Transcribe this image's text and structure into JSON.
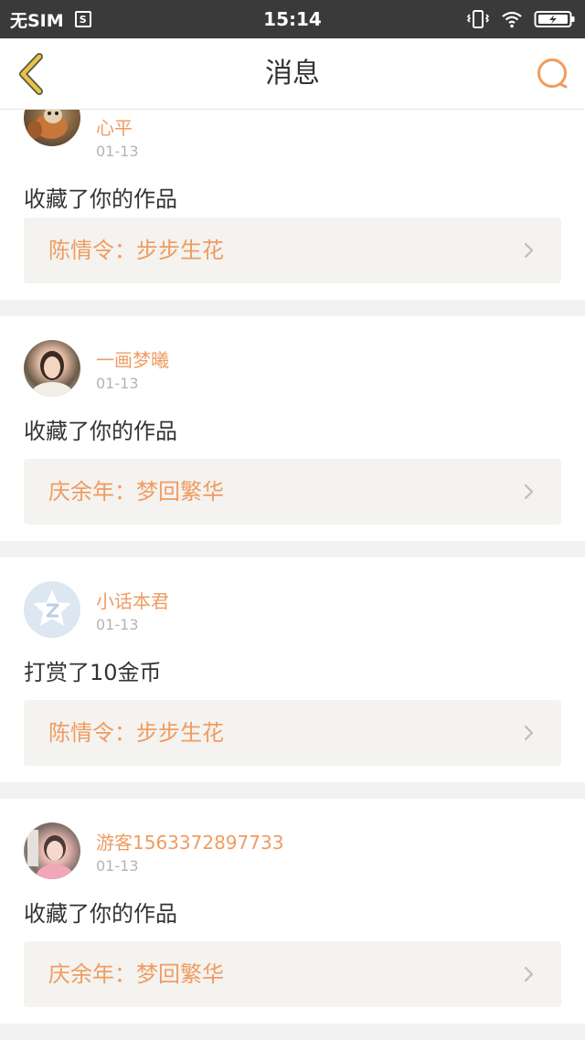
{
  "status_bar": {
    "carrier": "无SIM",
    "sim_icon_text": "S",
    "time": "15:14"
  },
  "header": {
    "title": "消息"
  },
  "colors": {
    "accent": "#ef9c62",
    "back_arrow": "#e8c34c",
    "status_bar_bg": "#3a3a3a"
  },
  "messages": [
    {
      "user": "心平",
      "date": "01-13",
      "action": "收藏了你的作品",
      "work": "陈情令：步步生花"
    },
    {
      "user": "一画梦曦",
      "date": "01-13",
      "action": "收藏了你的作品",
      "work": "庆余年：梦回繁华"
    },
    {
      "user": "小话本君",
      "date": "01-13",
      "action": "打赏了10金币",
      "work": "陈情令：步步生花"
    },
    {
      "user": "游客1563372897733",
      "date": "01-13",
      "action": "收藏了你的作品",
      "work": "庆余年：梦回繁华"
    }
  ]
}
